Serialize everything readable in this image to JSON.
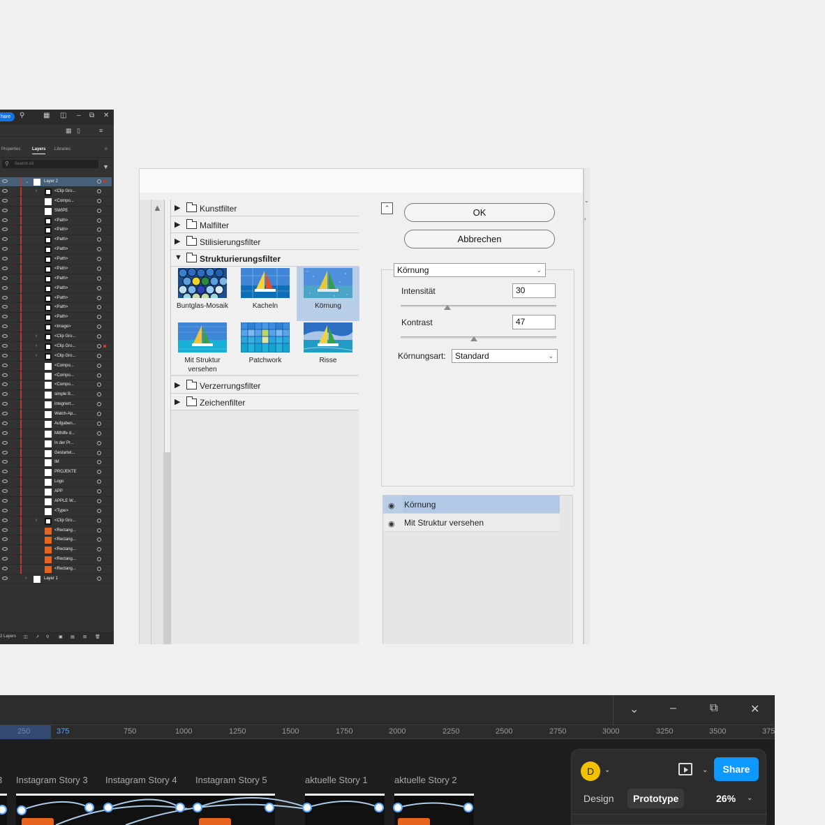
{
  "illustrator": {
    "share_label": "hare",
    "tabs": [
      "Properties",
      "Layers",
      "Libraries"
    ],
    "active_tab": "Layers",
    "search_placeholder": "Search All",
    "layer_rows": [
      "Layer 2",
      "<Clip Gro...",
      "<Compo...",
      "SWIPE",
      "<Path>",
      "<Path>",
      "<Path>",
      "<Path>",
      "<Path>",
      "<Path>",
      "<Path>",
      "<Path>",
      "<Path>",
      "<Path>",
      "<Path>",
      "<Image>",
      "<Clip Gro...",
      "<Clip Gro...",
      "<Clip Gro...",
      "<Compo...",
      "<Compo...",
      "<Compo...",
      "simple B...",
      "integriert...",
      "Watch-Ap...",
      "Aufgaben...",
      "Mithilfe d...",
      "In der Pr...",
      "Gestartet...",
      "IM",
      "PROJEKTE",
      "Logo",
      "APP",
      "APPLE W...",
      "<Type>",
      "<Clip Gro...",
      "<Rectang...",
      "<Rectang...",
      "<Rectang...",
      "<Rectang...",
      "<Rectang...",
      "Layer 1"
    ],
    "footer_count": "2 Layers"
  },
  "filter_gallery": {
    "categories_before": [
      "Kunstfilter",
      "Malfilter",
      "Stilisierungsfilter"
    ],
    "open_category": "Strukturierungsfilter",
    "categories_after": [
      "Verzerrungsfilter",
      "Zeichenfilter"
    ],
    "thumbnails": [
      {
        "label": "Buntglas-Mosaik"
      },
      {
        "label": "Kacheln"
      },
      {
        "label": "Körnung"
      },
      {
        "label": "Mit Struktur versehen"
      },
      {
        "label": "Patchwork"
      },
      {
        "label": "Risse"
      }
    ],
    "selected_thumbnail": "Körnung",
    "ok_label": "OK",
    "cancel_label": "Abbrechen",
    "filter_select": "Körnung",
    "intensity_label": "Intensität",
    "intensity_value": "30",
    "intensity_max": 100,
    "contrast_label": "Kontrast",
    "contrast_value": "47",
    "contrast_max": 100,
    "grain_type_label": "Körnungsart:",
    "grain_type_value": "Standard",
    "effect_layers": [
      "Körnung",
      "Mit Struktur versehen"
    ]
  },
  "figma": {
    "ruler_ticks": [
      "375",
      "750",
      "1000",
      "1250",
      "1500",
      "1750",
      "2000",
      "2250",
      "2500",
      "2750",
      "3000",
      "3250",
      "3500",
      "375"
    ],
    "ruler_highlight": "250",
    "frames": [
      "Instagram Story 3",
      "Instagram Story 4",
      "Instagram Story 5",
      "aktuelle Story 1",
      "aktuelle Story 2"
    ],
    "avatar_letter": "D",
    "share_label": "Share",
    "tab_design": "Design",
    "tab_prototype": "Prototype",
    "zoom": "26%"
  },
  "colors": {
    "figma_share": "#0d99ff",
    "ps_selection": "#b8cde6",
    "orange": "#e8631c"
  }
}
